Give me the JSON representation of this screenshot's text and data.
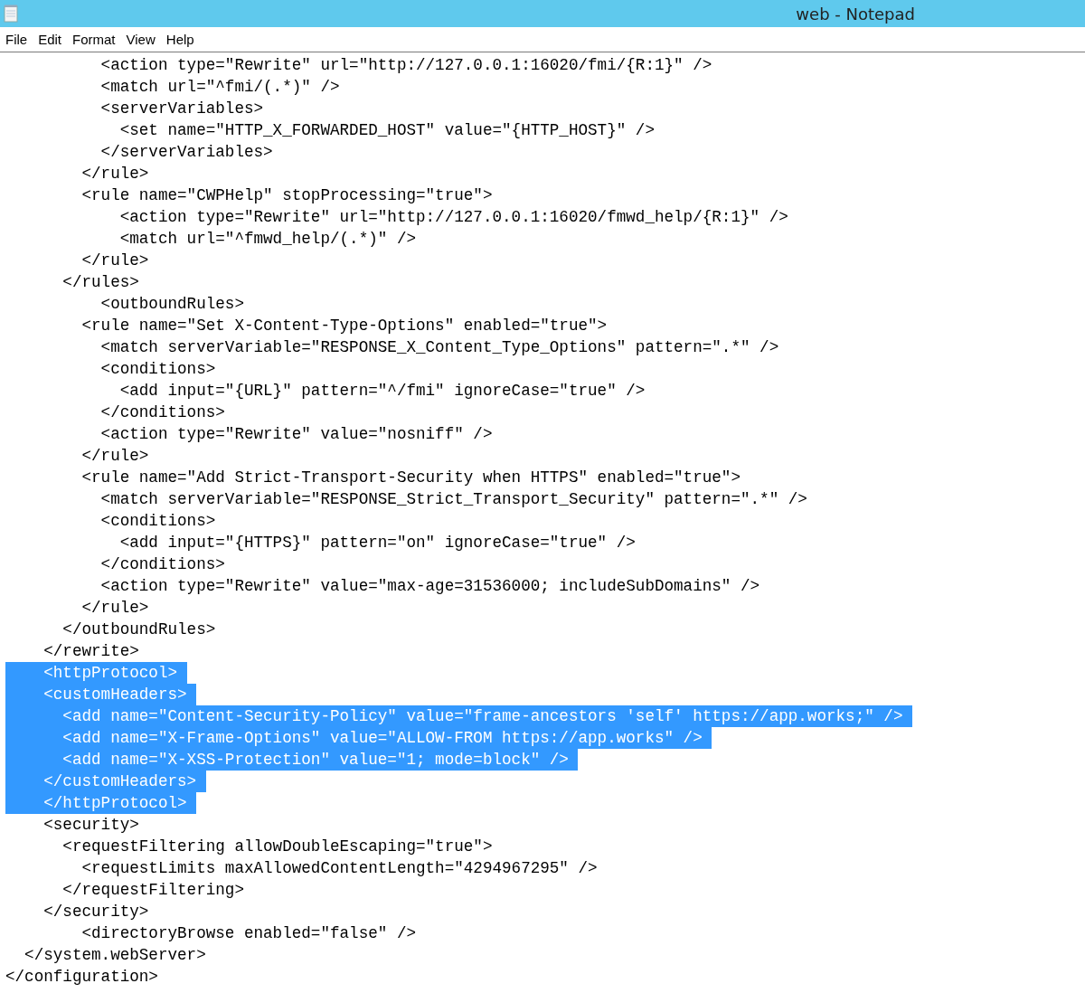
{
  "window": {
    "title": "web - Notepad"
  },
  "menu": [
    {
      "label": "File"
    },
    {
      "label": "Edit"
    },
    {
      "label": "Format"
    },
    {
      "label": "View"
    },
    {
      "label": "Help"
    }
  ],
  "lines": [
    {
      "text": "          <action type=\"Rewrite\" url=\"http://127.0.0.1:16020/fmi/{R:1}\" />",
      "selected": false
    },
    {
      "text": "          <match url=\"^fmi/(.*)\" />",
      "selected": false
    },
    {
      "text": "          <serverVariables>",
      "selected": false
    },
    {
      "text": "            <set name=\"HTTP_X_FORWARDED_HOST\" value=\"{HTTP_HOST}\" />",
      "selected": false
    },
    {
      "text": "          </serverVariables>",
      "selected": false
    },
    {
      "text": "        </rule>",
      "selected": false
    },
    {
      "text": "        <rule name=\"CWPHelp\" stopProcessing=\"true\">",
      "selected": false
    },
    {
      "text": "            <action type=\"Rewrite\" url=\"http://127.0.0.1:16020/fmwd_help/{R:1}\" />",
      "selected": false
    },
    {
      "text": "            <match url=\"^fmwd_help/(.*)\" />",
      "selected": false
    },
    {
      "text": "        </rule>",
      "selected": false
    },
    {
      "text": "      </rules>",
      "selected": false
    },
    {
      "text": "          <outboundRules>",
      "selected": false
    },
    {
      "text": "        <rule name=\"Set X-Content-Type-Options\" enabled=\"true\">",
      "selected": false
    },
    {
      "text": "          <match serverVariable=\"RESPONSE_X_Content_Type_Options\" pattern=\".*\" />",
      "selected": false
    },
    {
      "text": "          <conditions>",
      "selected": false
    },
    {
      "text": "            <add input=\"{URL}\" pattern=\"^/fmi\" ignoreCase=\"true\" />",
      "selected": false
    },
    {
      "text": "          </conditions>",
      "selected": false
    },
    {
      "text": "          <action type=\"Rewrite\" value=\"nosniff\" />",
      "selected": false
    },
    {
      "text": "        </rule>",
      "selected": false
    },
    {
      "text": "        <rule name=\"Add Strict-Transport-Security when HTTPS\" enabled=\"true\">",
      "selected": false
    },
    {
      "text": "          <match serverVariable=\"RESPONSE_Strict_Transport_Security\" pattern=\".*\" />",
      "selected": false
    },
    {
      "text": "          <conditions>",
      "selected": false
    },
    {
      "text": "            <add input=\"{HTTPS}\" pattern=\"on\" ignoreCase=\"true\" />",
      "selected": false
    },
    {
      "text": "          </conditions>",
      "selected": false
    },
    {
      "text": "          <action type=\"Rewrite\" value=\"max-age=31536000; includeSubDomains\" />",
      "selected": false
    },
    {
      "text": "        </rule>",
      "selected": false
    },
    {
      "text": "      </outboundRules>",
      "selected": false
    },
    {
      "text": "    </rewrite>",
      "selected": false
    },
    {
      "text": "    <httpProtocol>",
      "selected": true
    },
    {
      "text": "    <customHeaders>",
      "selected": true
    },
    {
      "text": "      <add name=\"Content-Security-Policy\" value=\"frame-ancestors 'self' https://app.works;\" />",
      "selected": true
    },
    {
      "text": "      <add name=\"X-Frame-Options\" value=\"ALLOW-FROM https://app.works\" />",
      "selected": true
    },
    {
      "text": "      <add name=\"X-XSS-Protection\" value=\"1; mode=block\" />",
      "selected": true
    },
    {
      "text": "    </customHeaders>",
      "selected": true
    },
    {
      "text": "    </httpProtocol>",
      "selected": true
    },
    {
      "text": "    <security>",
      "selected": false
    },
    {
      "text": "      <requestFiltering allowDoubleEscaping=\"true\">",
      "selected": false
    },
    {
      "text": "        <requestLimits maxAllowedContentLength=\"4294967295\" />",
      "selected": false
    },
    {
      "text": "      </requestFiltering>",
      "selected": false
    },
    {
      "text": "    </security>",
      "selected": false
    },
    {
      "text": "        <directoryBrowse enabled=\"false\" />",
      "selected": false
    },
    {
      "text": "  </system.webServer>",
      "selected": false
    },
    {
      "text": "</configuration>",
      "selected": false
    }
  ]
}
